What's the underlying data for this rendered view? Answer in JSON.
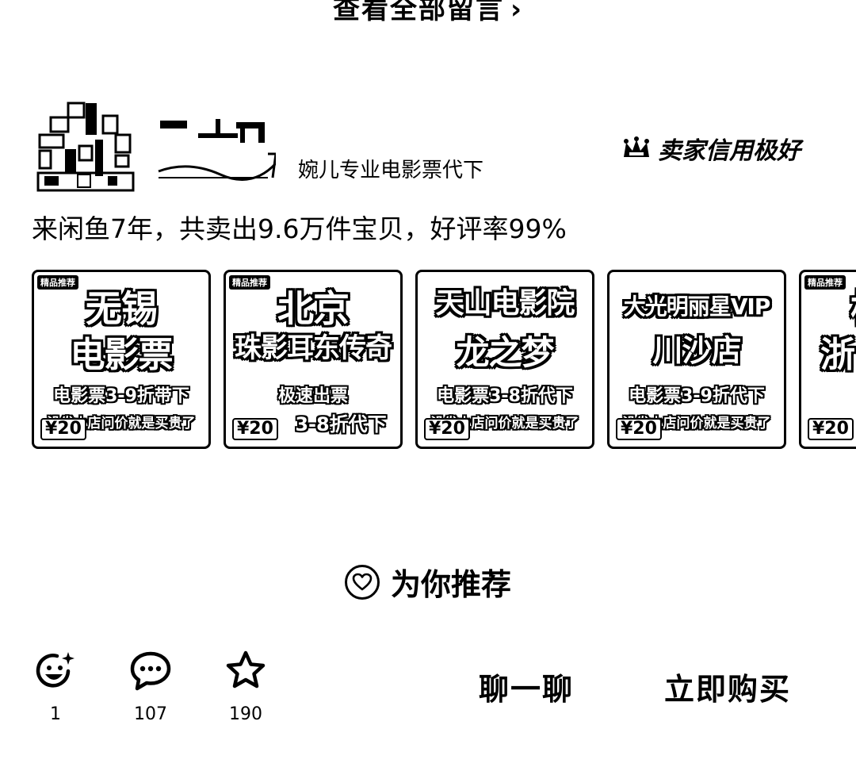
{
  "top": {
    "view_all_label": "查看全部留言",
    "chevron": "›"
  },
  "seller": {
    "avatar_icon": "pixel-avatar",
    "name_image": "handwritten-name",
    "subtitle": "婉儿专业电影票代下",
    "credit_label": "卖家信用极好",
    "credit_icon": "crown-icon",
    "stats": "来闲鱼7年，共卖出9.6万件宝贝，好评率99%"
  },
  "products": [
    {
      "badge": "",
      "line1": "无锡",
      "line2": "电影票",
      "line3": "电影票3-9折带下",
      "line4": "没发小店问价就是买贵了",
      "price": "¥20"
    },
    {
      "badge": "",
      "line1": "北京",
      "line2": "珠影耳东传奇",
      "line3": "极速出票",
      "line4": "3-8折代下",
      "price": "¥20"
    },
    {
      "badge": "",
      "line1": "天山电影院",
      "line2": "龙之梦",
      "line3": "电影票3-8折代下",
      "line4": "没发小店问价就是买贵了",
      "price": "¥20"
    },
    {
      "badge": "",
      "line1": "大光明丽星VIP",
      "line2": "川沙店",
      "line3": "电影票3-9折代下",
      "line4": "没发小店问价就是买贵了",
      "price": "¥20"
    },
    {
      "badge": "",
      "line1": "杭",
      "line2": "浙",
      "line3": "",
      "line4": "",
      "price": "¥20"
    }
  ],
  "recommend": {
    "label": "为你推荐",
    "icon": "heart-icon"
  },
  "bottom_bar": {
    "like_count": "1",
    "comment_count": "107",
    "favorite_count": "190",
    "chat_label": "聊一聊",
    "buy_label": "立即购买"
  }
}
